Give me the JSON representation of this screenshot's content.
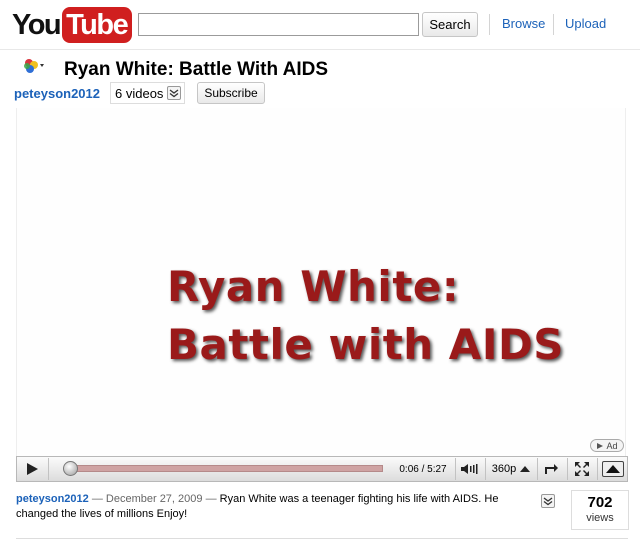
{
  "header": {
    "logo_you": "You",
    "logo_tube": "Tube",
    "search_value": "",
    "search_button": "Search",
    "nav": [
      {
        "label": "Browse"
      },
      {
        "label": "Upload"
      }
    ]
  },
  "video": {
    "title": "Ryan White: Battle With AIDS",
    "channel": "peteyson2012",
    "video_count": "6 videos",
    "subscribe_label": "Subscribe",
    "frame_line1": "Ryan White:",
    "frame_line2": "Battle with AIDS",
    "ad_label": "Ad"
  },
  "player": {
    "current_time": "0:06",
    "duration": "5:27",
    "time_display": "0:06 / 5:27",
    "quality": "360p",
    "progress_fraction": 0.018
  },
  "description": {
    "user": "peteyson2012",
    "date": "December 27, 2009",
    "text": "Ryan White was a teenager fighting his life with AIDS. He changed the lives of millions Enjoy!",
    "views_count": "702",
    "views_label": "views"
  },
  "colors": {
    "link": "#1c62b9",
    "logo_red": "#d01f1f",
    "video_text": "#9a1a1a"
  }
}
